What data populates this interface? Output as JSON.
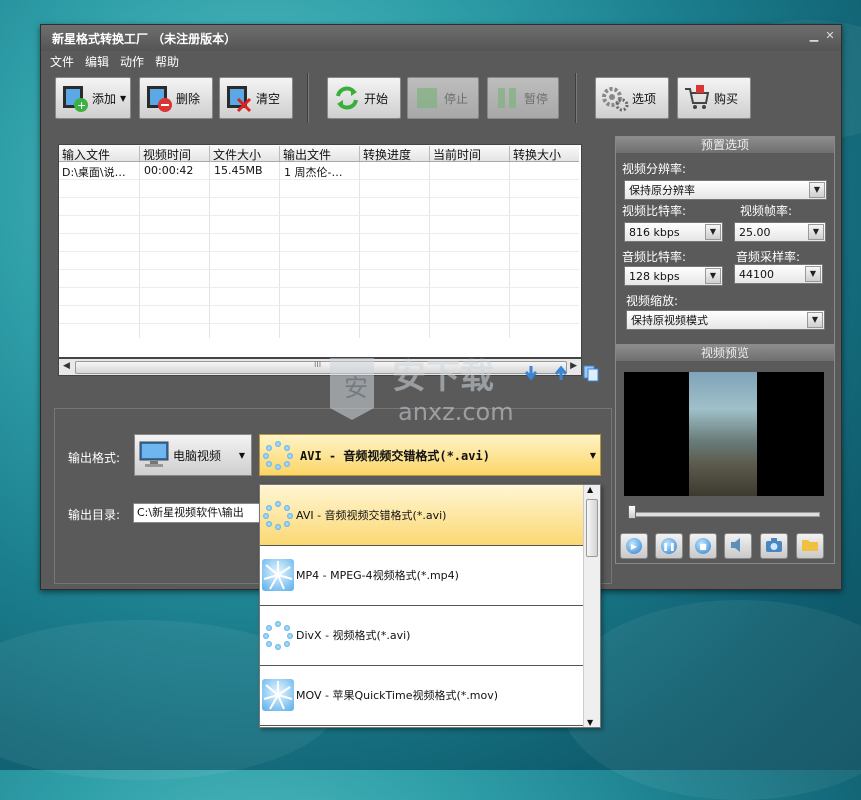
{
  "window": {
    "title": "新星格式转换工厂 （未注册版本）"
  },
  "menu": [
    "文件",
    "编辑",
    "动作",
    "帮助"
  ],
  "toolbar": {
    "add": "添加",
    "delete": "删除",
    "clear": "清空",
    "start": "开始",
    "stop": "停止",
    "pause": "暂停",
    "options": "选项",
    "buy": "购买"
  },
  "table": {
    "columns": [
      "输入文件",
      "视频时间",
      "文件大小",
      "输出文件",
      "转换进度",
      "当前时间",
      "转换大小"
    ],
    "rows": [
      [
        "D:\\桌面\\说…",
        "00:00:42",
        "15.45MB",
        "1 周杰伦-…",
        "",
        "",
        ""
      ]
    ]
  },
  "output": {
    "format_label": "输出格式:",
    "device": "电脑视频",
    "format": "AVI - 音频视频交错格式(*.avi)",
    "dir_label": "输出目录:",
    "dir_value": "C:\\新星视频软件\\输出"
  },
  "preset": {
    "title": "预置选项",
    "resolution_label": "视频分辨率:",
    "resolution": "保持原分辨率",
    "vbitrate_label": "视频比特率:",
    "vbitrate": "816 kbps",
    "fps_label": "视频帧率:",
    "fps": "25.00",
    "abitrate_label": "音频比特率:",
    "abitrate": "128 kbps",
    "samplerate_label": "音频采样率:",
    "samplerate": "44100",
    "scale_label": "视频缩放:",
    "scale": "保持原视频模式"
  },
  "preview": {
    "title": "视频预览"
  },
  "dropdown": {
    "items": [
      "AVI - 音频视频交错格式(*.avi)",
      "MP4 - MPEG-4视频格式(*.mp4)",
      "DivX - 视频格式(*.avi)",
      "MOV - 苹果QuickTime视频格式(*.mov)"
    ]
  },
  "watermark": "anxz.com"
}
